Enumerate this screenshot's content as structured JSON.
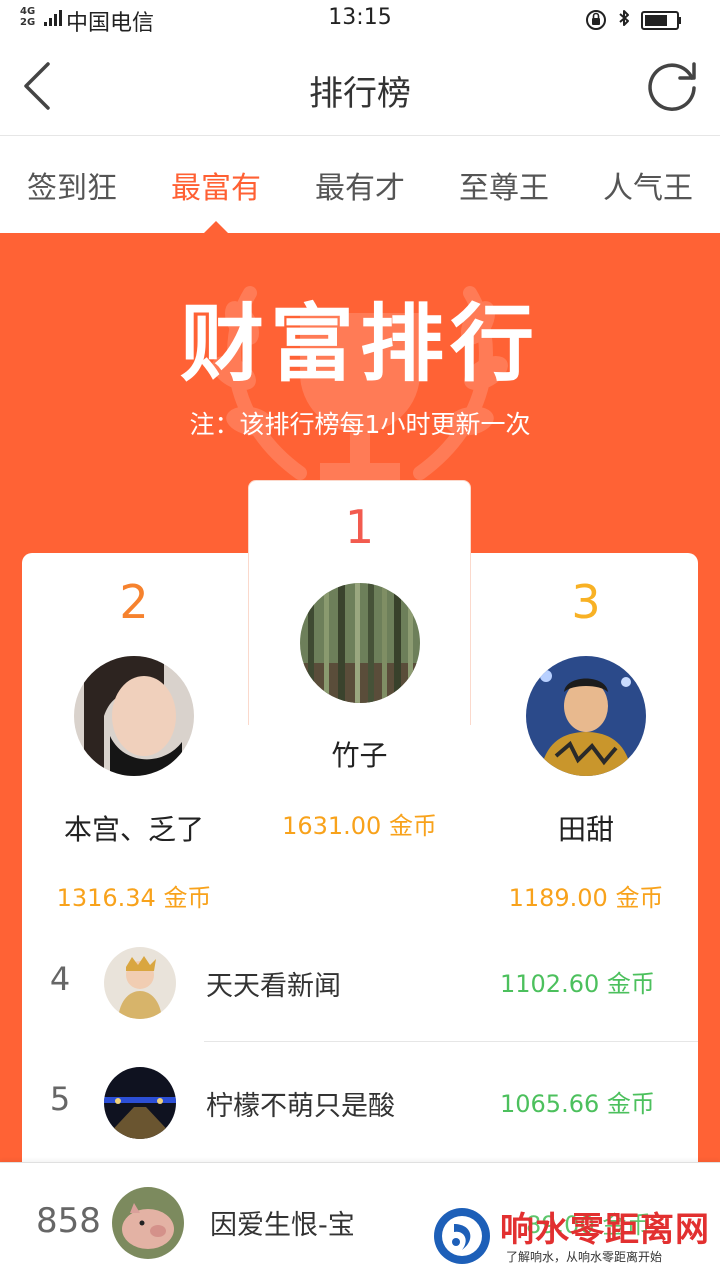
{
  "status_bar": {
    "network_top": "4G",
    "network_bottom": "2G",
    "carrier": "中国电信",
    "time": "13:15"
  },
  "navbar": {
    "title": "排行榜",
    "back_icon": "chevron-left-icon",
    "refresh_icon": "refresh-icon"
  },
  "tabs": [
    {
      "label": "签到狂",
      "active": false
    },
    {
      "label": "最富有",
      "active": true
    },
    {
      "label": "最有才",
      "active": false
    },
    {
      "label": "至尊王",
      "active": false
    },
    {
      "label": "人气王",
      "active": false
    }
  ],
  "hero": {
    "title": "财富排行",
    "note": "注：该排行榜每1小时更新一次"
  },
  "podium": {
    "first": {
      "rank": "1",
      "name": "竹子",
      "coins": "1631.00 金币"
    },
    "second": {
      "rank": "2",
      "name": "本宫、乏了",
      "coins": "1316.34 金币"
    },
    "third": {
      "rank": "3",
      "name": "田甜",
      "coins": "1189.00 金币"
    }
  },
  "list": [
    {
      "rank": "4",
      "name": "天天看新闻",
      "coins": "1102.60 金币"
    },
    {
      "rank": "5",
      "name": "柠檬不萌只是酸",
      "coins": "1065.66 金币"
    }
  ],
  "my_rank": {
    "rank": "858",
    "name": "因爱生恨-宝",
    "coins": "89.00 金币"
  },
  "watermark": {
    "main": "响水零距离网",
    "sub": "了解响水，从响水零距离开始"
  },
  "colors": {
    "accent": "#ff6235",
    "active_tab": "#ff6033",
    "gold": "#f8a21b",
    "green": "#4cc05d",
    "rank1": "#f25b4f",
    "rank2": "#f6822e",
    "rank3": "#f8b124"
  }
}
